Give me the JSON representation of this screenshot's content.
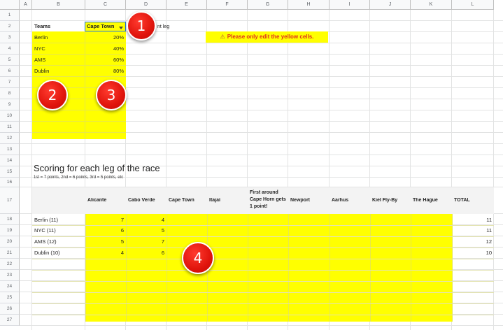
{
  "columns": [
    "A",
    "B",
    "C",
    "D",
    "E",
    "F",
    "G",
    "H",
    "I",
    "J",
    "K",
    "L"
  ],
  "rows": [
    "1",
    "2",
    "3",
    "4",
    "5",
    "6",
    "7",
    "8",
    "9",
    "10",
    "11",
    "12",
    "13",
    "14",
    "15",
    "16",
    "17",
    "18",
    "19",
    "20",
    "21",
    "22",
    "23",
    "24",
    "25",
    "26",
    "27"
  ],
  "teams_table": {
    "header_label": "Teams",
    "selected_leg": "Cape Town",
    "teams": [
      {
        "name": "Berlin",
        "pct": "20%"
      },
      {
        "name": "NYC",
        "pct": "40%"
      },
      {
        "name": "AMS",
        "pct": "60%"
      },
      {
        "name": "Dublin",
        "pct": "80%"
      }
    ]
  },
  "leg_label_fragment": "nt leg",
  "warning": {
    "icon": "warning-icon",
    "text": "Please only edit the yellow cells."
  },
  "scoring": {
    "title": "Scoring for each leg of the race",
    "subtitle": "1st = 7 points, 2nd = 6 points, 3rd = 5 points, etc",
    "legs": [
      "Alicante",
      "Cabo Verde",
      "Cape Town",
      "Itajaí",
      "First around Cape Horn gets 1 point!",
      "Newport",
      "Aarhus",
      "Kiel Fly-By",
      "The Hague"
    ],
    "total_label": "TOTAL",
    "rows": [
      {
        "team": "Berlin (11)",
        "alicante": "7",
        "cabo_verde": "4",
        "total": "11"
      },
      {
        "team": "NYC (11)",
        "alicante": "6",
        "cabo_verde": "5",
        "total": "11"
      },
      {
        "team": "AMS (12)",
        "alicante": "5",
        "cabo_verde": "7",
        "total": "12"
      },
      {
        "team": "Dublin (10)",
        "alicante": "4",
        "cabo_verde": "6",
        "total": "10"
      }
    ]
  },
  "badges": [
    "1",
    "2",
    "3",
    "4"
  ],
  "colors": {
    "highlight": "#ffff00",
    "badge": "#e0140c",
    "warning_text": "#e0301e"
  }
}
